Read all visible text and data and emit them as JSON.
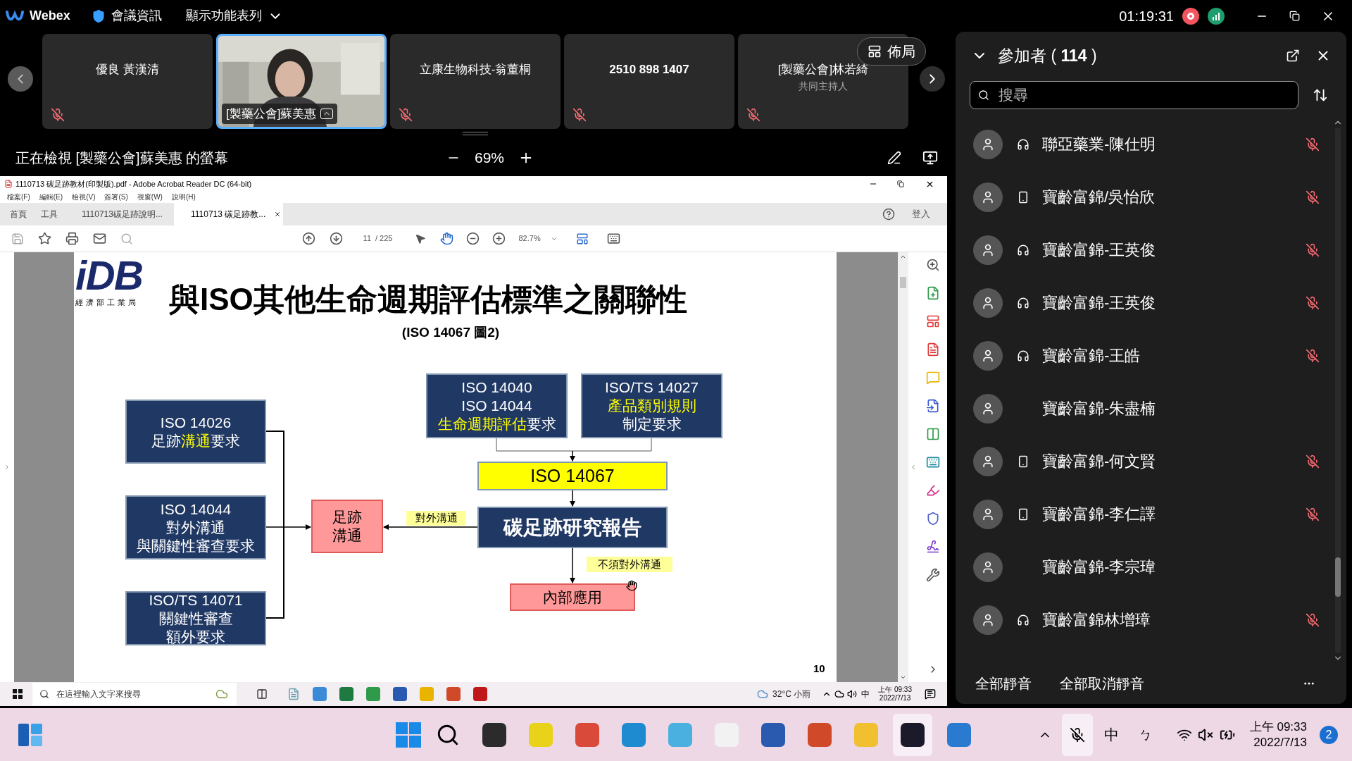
{
  "topbar": {
    "app_name": "Webex",
    "meeting_info": "會議資訊",
    "show_menu": "顯示功能表列",
    "timer": "01:19:31"
  },
  "strip": {
    "tiles": [
      {
        "name": "優良 黃漢清",
        "kind": "user",
        "muted": true,
        "video": false,
        "selected": false
      },
      {
        "name": "[製藥公會]蘇美惠",
        "kind": "user",
        "muted": false,
        "video": true,
        "selected": true
      },
      {
        "name": "立康生物科技-翁董桐",
        "kind": "user",
        "muted": true,
        "video": false,
        "selected": false
      },
      {
        "name": "2510 898 1407",
        "kind": "dial-in",
        "muted": true,
        "video": false,
        "selected": false
      },
      {
        "name": "[製藥公會]林若綺",
        "role": "共同主持人",
        "kind": "user",
        "muted": true,
        "video": false,
        "selected": false
      }
    ],
    "layout_button": "佈局"
  },
  "viewer": {
    "label": "正在檢視 [製藥公會]蘇美惠 的螢幕",
    "zoom": "69%"
  },
  "acrobat": {
    "title": "1110713 碳足跡教材(印製版).pdf - Adobe Acrobat Reader DC (64-bit)",
    "menu": [
      "檔案(F)",
      "編輯(E)",
      "檢視(V)",
      "簽署(S)",
      "視窗(W)",
      "說明(H)"
    ],
    "tabs": [
      {
        "label": "首頁",
        "kind": "nav",
        "selected": false
      },
      {
        "label": "工具",
        "kind": "nav",
        "selected": false
      },
      {
        "label": "1110713碳足跡說明...",
        "kind": "doc",
        "selected": false
      },
      {
        "label": "1110713 碳足跡教...",
        "kind": "doc",
        "selected": true
      }
    ],
    "sign_in": "登入",
    "page": "11",
    "page_total": "/ 225",
    "zoom": "82.7%"
  },
  "slide": {
    "logo": "iDB",
    "logo_caption": "經濟部工業局",
    "title": "與ISO其他生命週期評估標準之關聯性",
    "subtitle": "(ISO 14067 圖2)",
    "nodes": [
      {
        "kind": "dark",
        "lines": [
          "ISO 14026",
          "足跡**溝通**要求"
        ]
      },
      {
        "kind": "dark",
        "lines": [
          "ISO 14044",
          "對外溝通",
          "與關鍵性審查要求"
        ]
      },
      {
        "kind": "dark",
        "lines": [
          "ISO/TS 14071",
          "關鍵性審查",
          "額外要求"
        ]
      },
      {
        "kind": "pink",
        "lines": [
          "足跡",
          "溝通"
        ]
      },
      {
        "kind": "dark",
        "lines": [
          "ISO 14040",
          "ISO 14044",
          "**生命週期評估**要求"
        ]
      },
      {
        "kind": "dark",
        "lines": [
          "ISO/TS 14027",
          "**產品類別規則**",
          "制定要求"
        ]
      },
      {
        "kind": "yellow",
        "lines": [
          "ISO 14067"
        ]
      },
      {
        "kind": "dark-large",
        "lines": [
          "碳足跡研究報告"
        ]
      },
      {
        "kind": "note",
        "lines": [
          "對外溝通"
        ]
      },
      {
        "kind": "note",
        "lines": [
          "不須對外溝通"
        ]
      },
      {
        "kind": "pink",
        "lines": [
          "內部應用"
        ]
      }
    ],
    "page_number": "10"
  },
  "inner_taskbar": {
    "search_placeholder": "在這裡輸入文字來搜尋",
    "weather": "32°C 小雨",
    "ime": "中",
    "time": "上午 09:33",
    "date": "2022/7/13"
  },
  "panel": {
    "title": "參加者 ( **114** )",
    "search_placeholder": "搜尋",
    "participants": [
      {
        "name": "聯亞藥業-陳仕明",
        "kind": "headset",
        "muted": true
      },
      {
        "name": "寶齡富錦/吳怡欣",
        "kind": "phone",
        "muted": true
      },
      {
        "name": "寶齡富錦-王英俊",
        "kind": "headset",
        "muted": true
      },
      {
        "name": "寶齡富錦-王英俊",
        "kind": "headset",
        "muted": true
      },
      {
        "name": "寶齡富錦-王皓",
        "kind": "headset",
        "muted": true
      },
      {
        "name": "寶齡富錦-朱盡楠",
        "kind": "web",
        "muted": false
      },
      {
        "name": "寶齡富錦-何文賢",
        "kind": "phone",
        "muted": true
      },
      {
        "name": "寶齡富錦-李仁譯",
        "kind": "phone",
        "muted": true
      },
      {
        "name": "寶齡富錦-李宗瑋",
        "kind": "web",
        "muted": false
      },
      {
        "name": "寶齡富錦林增璋",
        "kind": "headset",
        "muted": true
      }
    ],
    "mute_all": "全部靜音",
    "unmute_all": "全部取消靜音"
  },
  "taskbar": {
    "ime": "中",
    "ime_mode": "ㄅ",
    "time": "上午 09:33",
    "date": "2022/7/13",
    "notifications": "2"
  }
}
